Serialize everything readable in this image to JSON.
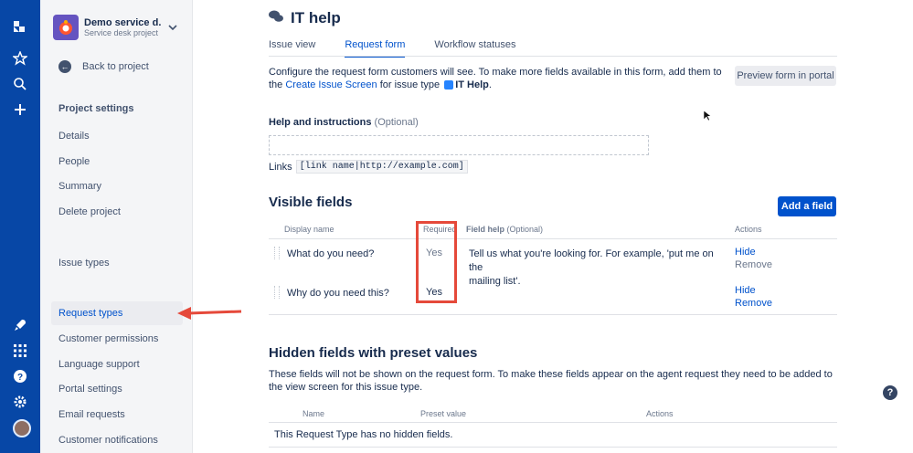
{
  "sidebar": {
    "project_name": "Demo service d...",
    "project_type": "Service desk project",
    "back": "Back to project",
    "section_title": "Project settings",
    "items": [
      {
        "label": "Details"
      },
      {
        "label": "People"
      },
      {
        "label": "Summary"
      },
      {
        "label": "Delete project"
      },
      {
        "label": "Issue types"
      },
      {
        "label": "Request types"
      },
      {
        "label": "Customer permissions"
      },
      {
        "label": "Language support"
      },
      {
        "label": "Portal settings"
      },
      {
        "label": "Email requests"
      },
      {
        "label": "Customer notifications"
      }
    ],
    "active_item": "Request types"
  },
  "header": {
    "title": "IT help",
    "tabs": [
      {
        "label": "Issue view"
      },
      {
        "label": "Request form"
      },
      {
        "label": "Workflow statuses"
      }
    ],
    "active_tab": "Request form"
  },
  "intro": {
    "text_1": "Configure the request form customers will see. To make more fields available in this form, add them to the",
    "link": "Create Issue Screen",
    "text_2": "for issue type",
    "issue_type": "IT Help",
    "period": "."
  },
  "preview_button": "Preview form in portal",
  "help": {
    "label": "Help and instructions",
    "optional": "(Optional)",
    "links_label": "Links",
    "links_code": "[link name|http://example.com]"
  },
  "visible_fields": {
    "title": "Visible fields",
    "add_button": "Add a field",
    "columns": {
      "display_name": "Display name",
      "required": "Required",
      "field_help": "Field help",
      "field_help_optional": "(Optional)",
      "actions": "Actions"
    },
    "rows": [
      {
        "name": "What do you need?",
        "required": "Yes",
        "help_line1": "Tell us what you're looking for. For example, 'put me on the",
        "help_line2": "mailing list'.",
        "action_1": "Hide",
        "action_2": "Remove"
      },
      {
        "name": "Why do you need this?",
        "required": "Yes",
        "help_line1": "",
        "help_line2": "",
        "action_1": "Hide",
        "action_2": "Remove"
      }
    ]
  },
  "hidden_fields": {
    "title": "Hidden fields with preset values",
    "description": "These fields will not be shown on the request form. To make these fields appear on the agent request they need to be added to the view screen for this issue type.",
    "columns": {
      "name": "Name",
      "preset": "Preset value",
      "actions": "Actions"
    },
    "empty": "This Request Type has no hidden fields."
  },
  "colors": {
    "accent": "#0052cc",
    "rail": "#0747a6",
    "annotation": "#e5493a"
  }
}
